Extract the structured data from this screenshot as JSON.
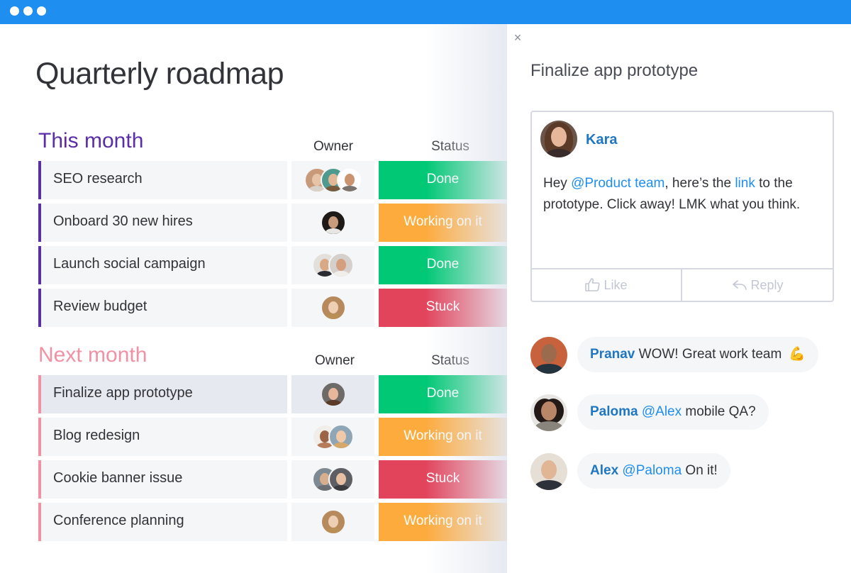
{
  "window": {
    "controls": [
      "dot",
      "dot",
      "dot"
    ]
  },
  "board": {
    "title": "Quarterly roadmap",
    "groups": [
      {
        "title": "This month",
        "color": "#5a2ea6",
        "columns": {
          "owner": "Owner",
          "status": "Status"
        },
        "rows": [
          {
            "task": "SEO research",
            "owners": 3,
            "status": "Done"
          },
          {
            "task": "Onboard 30 new hires",
            "owners": 1,
            "status": "Working on it"
          },
          {
            "task": "Launch social campaign",
            "owners": 2,
            "status": "Done"
          },
          {
            "task": "Review budget",
            "owners": 1,
            "status": "Stuck"
          }
        ]
      },
      {
        "title": "Next month",
        "color": "#f191a4",
        "columns": {
          "owner": "Owner",
          "status": "Status"
        },
        "rows": [
          {
            "task": "Finalize app prototype",
            "owners": 1,
            "status": "Done",
            "selected": true
          },
          {
            "task": "Blog redesign",
            "owners": 2,
            "status": "Working on it"
          },
          {
            "task": "Cookie banner issue",
            "owners": 2,
            "status": "Stuck"
          },
          {
            "task": "Conference planning",
            "owners": 1,
            "status": "Working on it"
          }
        ]
      }
    ],
    "status_colors": {
      "Done": "#00c875",
      "Working on it": "#fdab3d",
      "Stuck": "#e2445c"
    }
  },
  "panel": {
    "close_icon": "×",
    "title": "Finalize app prototype",
    "post": {
      "author": "Kara",
      "text_parts": [
        "Hey ",
        "@Product team",
        ", here’s the ",
        "link",
        " to the prototype. Click away! LMK what you think."
      ],
      "like_label": "Like",
      "reply_label": "Reply"
    },
    "replies": [
      {
        "name": "Pranav",
        "mention": "",
        "text": "WOW! Great work team",
        "emoji": "💪"
      },
      {
        "name": "Paloma",
        "mention": "@Alex",
        "text": "mobile QA?",
        "emoji": ""
      },
      {
        "name": "Alex",
        "mention": "@Paloma",
        "text": "On it!",
        "emoji": ""
      }
    ]
  },
  "colors": {
    "topbar": "#1f8ef1",
    "mention": "#1f8ef1",
    "author": "#1f76c2"
  }
}
